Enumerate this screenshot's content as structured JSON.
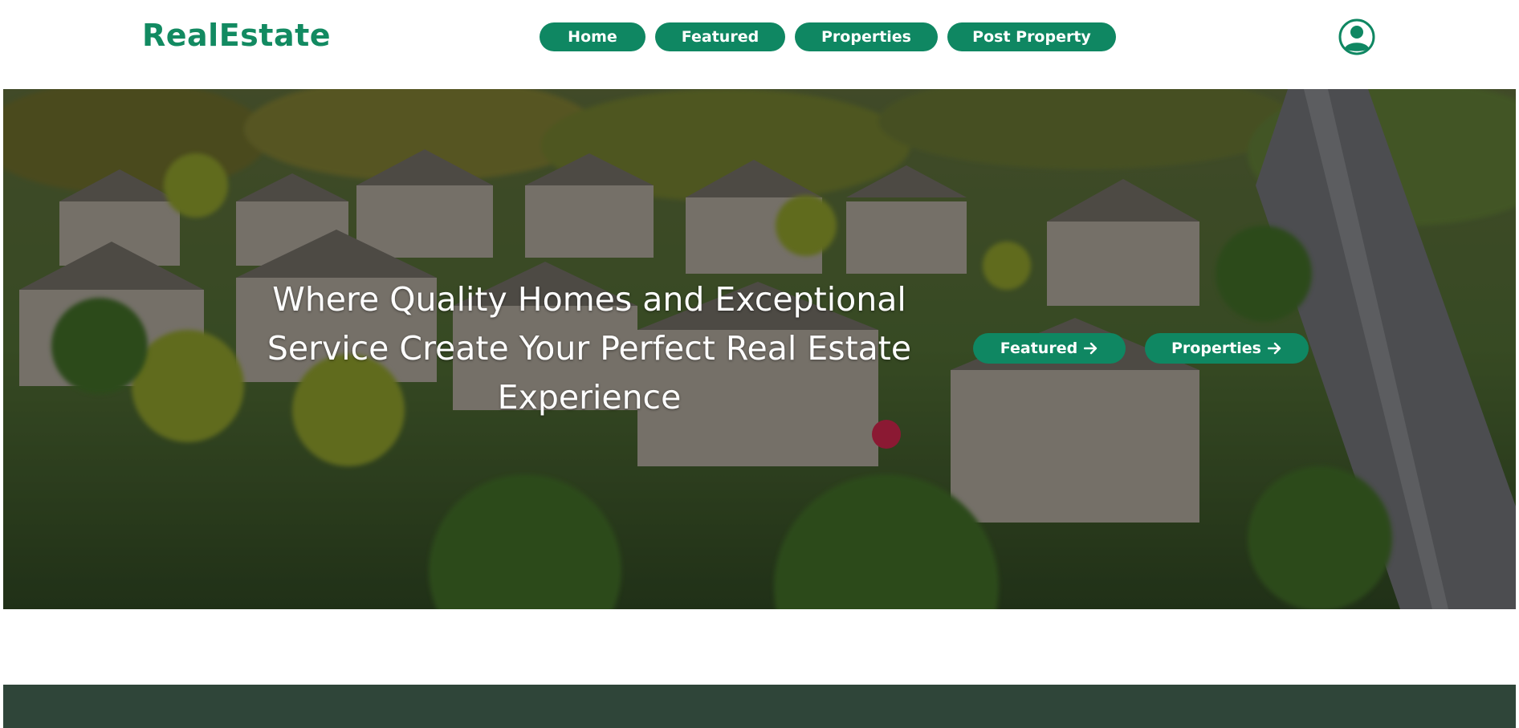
{
  "header": {
    "logo": "RealEstate",
    "nav": [
      {
        "label": "Home"
      },
      {
        "label": "Featured"
      },
      {
        "label": "Properties"
      },
      {
        "label": "Post Property"
      }
    ],
    "user_icon": "user-circle-icon"
  },
  "hero": {
    "title": "Where Quality Homes and Exceptional Service Create Your Perfect Real Estate Experience",
    "buttons": [
      {
        "label": "Featured",
        "icon": "arrow-right-icon"
      },
      {
        "label": "Properties",
        "icon": "arrow-right-icon"
      }
    ]
  },
  "colors": {
    "brand": "#128a61",
    "button": "#0f8762",
    "footer_band": "#2f4539"
  }
}
